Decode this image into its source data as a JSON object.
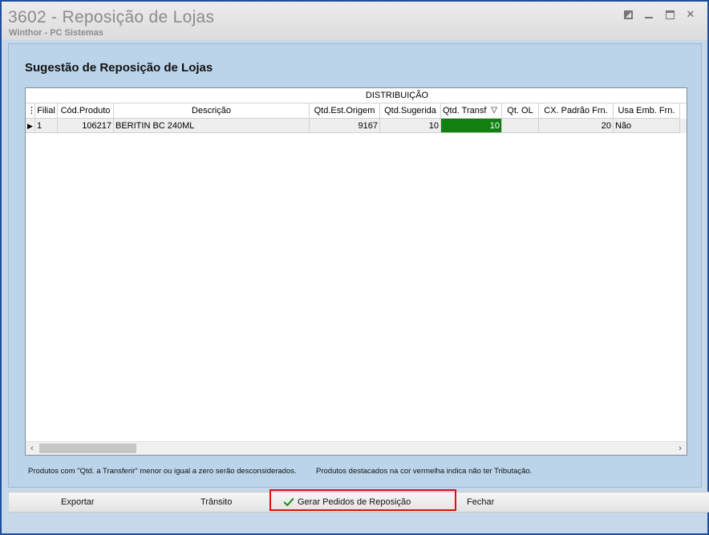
{
  "window": {
    "title": "3602 - Reposição de Lojas",
    "subtitle": "Winthor - PC Sistemas"
  },
  "page": {
    "section_title": "Sugestão de Reposição de Lojas"
  },
  "grid": {
    "band_label": "DISTRIBUIÇÃO",
    "columns": [
      "Filial",
      "Cód.Produto",
      "Descrição",
      "Qtd.Est.Origem",
      "Qtd.Sugerida",
      "Qtd. Transf",
      "Qt. OL",
      "CX. Padrão Frn.",
      "Usa Emb. Frn."
    ],
    "sort_indicator": "▽",
    "rows": [
      {
        "filial": "1",
        "cod_produto": "106217",
        "descricao": "BERITIN BC 240ML",
        "qtd_est_origem": "9167",
        "qtd_sugerida": "10",
        "qtd_transf": "10",
        "qt_ol": "",
        "cx_padrao_frn": "20",
        "usa_emb_frn": "Não"
      }
    ]
  },
  "notes": {
    "left": "Produtos com \"Qtd. a Transferir\" menor ou igual a zero serão desconsiderados.",
    "right": "Produtos destacados na cor vermelha indica não ter Tributação."
  },
  "toolbar": {
    "exportar": "Exportar",
    "transito": "Trânsito",
    "gerar": "Gerar Pedidos de Reposição",
    "fechar": "Fechar"
  },
  "colors": {
    "highlight_cell": "#118011",
    "focus_box": "#e01010",
    "window_border": "#1e4f9c"
  }
}
